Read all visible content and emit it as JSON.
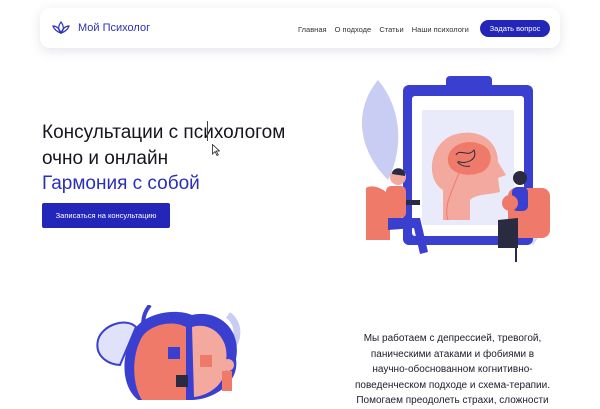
{
  "header": {
    "brand": "Мой Психолог",
    "nav": [
      "Главная",
      "О подходе",
      "Статьи",
      "Наши психологи"
    ],
    "ask_button": "Задать вопрос"
  },
  "hero": {
    "title_line1": "Консультации с психологом",
    "title_line2": "очно и онлайн",
    "subtitle": "Гармония с собой",
    "cta": "Записаться на консультацию"
  },
  "about": {
    "lines": [
      "Мы работаем с депрессией, тревогой,",
      "паническими атаками и фобиями в",
      "научно-обоснованном когнитивно-",
      "поведенческом подходе и схема-терапии.",
      "Помогаем преодолеть страхи, сложности"
    ]
  },
  "colors": {
    "accent": "#2326b8",
    "brain": "#ef7a6a",
    "illustration_blue": "#3a3fd0",
    "illustration_light": "#c9cdf3"
  }
}
